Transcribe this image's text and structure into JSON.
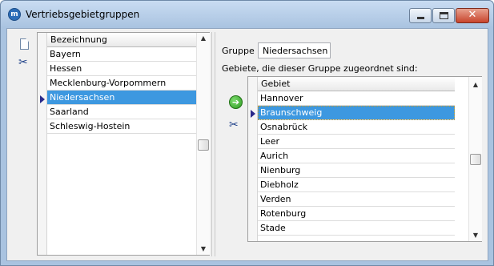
{
  "window": {
    "title": "Vertriebsgebietgruppen",
    "app_icon_letter": "m",
    "controls": {
      "minimize": "",
      "maximize": "",
      "close": "✕"
    }
  },
  "toolbar_icons": [
    "new-document-icon",
    "scissors-icon"
  ],
  "groups_grid": {
    "header": "Bezeichnung",
    "selected_index": 3,
    "rows": [
      "Bayern",
      "Hessen",
      "Mecklenburg-Vorpommern",
      "Niedersachsen",
      "Saarland",
      "Schleswig-Hostein"
    ]
  },
  "detail": {
    "group_label": "Gruppe",
    "group_value": "Niedersachsen",
    "areas_caption": "Gebiete, die dieser Gruppe zugeordnet sind:",
    "areas_grid": {
      "header": "Gebiet",
      "selected_index": 1,
      "rows": [
        "Hannover",
        "Braunschweig",
        "Osnabrück",
        "Leer",
        "Aurich",
        "Nienburg",
        "Diebholz",
        "Verden",
        "Rotenburg",
        "Stade"
      ]
    }
  },
  "colors": {
    "selection": "#3d98e0",
    "title_bar": "#a9c3e0"
  }
}
